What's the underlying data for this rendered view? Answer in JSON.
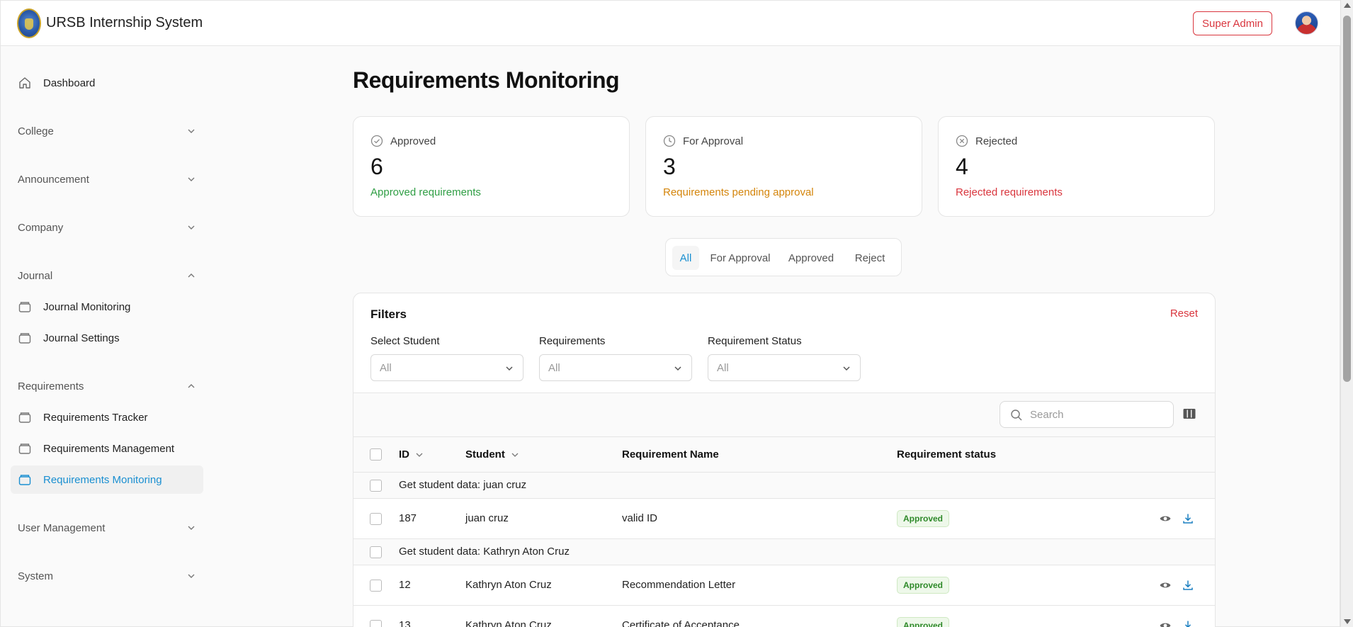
{
  "header": {
    "app_title": "URSB Internship System",
    "role_button": "Super Admin"
  },
  "sidebar": {
    "dashboard": "Dashboard",
    "college": "College",
    "announcement": "Announcement",
    "company": "Company",
    "journal": "Journal",
    "journal_monitoring": "Journal Monitoring",
    "journal_settings": "Journal Settings",
    "requirements": "Requirements",
    "requirements_tracker": "Requirements Tracker",
    "requirements_management": "Requirements Management",
    "requirements_monitoring": "Requirements Monitoring",
    "user_management": "User Management",
    "system": "System"
  },
  "page": {
    "title": "Requirements Monitoring"
  },
  "stats": {
    "approved": {
      "label": "Approved",
      "value": "6",
      "desc": "Approved requirements",
      "color": "#2f9e44"
    },
    "for_approval": {
      "label": "For Approval",
      "value": "3",
      "desc": "Requirements pending approval",
      "color": "#d4850b"
    },
    "rejected": {
      "label": "Rejected",
      "value": "4",
      "desc": "Rejected requirements",
      "color": "#d9363e"
    }
  },
  "tabs": {
    "all": "All",
    "for_approval": "For Approval",
    "approved": "Approved",
    "reject": "Reject"
  },
  "filters": {
    "title": "Filters",
    "reset": "Reset",
    "student_label": "Select Student",
    "student_value": "All",
    "requirements_label": "Requirements",
    "requirements_value": "All",
    "status_label": "Requirement Status",
    "status_value": "All"
  },
  "table": {
    "search_placeholder": "Search",
    "headers": {
      "id": "ID",
      "student": "Student",
      "requirement_name": "Requirement Name",
      "requirement_status": "Requirement status"
    },
    "groups": [
      {
        "title": "Get student data: juan cruz"
      },
      {
        "title": "Get student data: Kathryn Aton Cruz"
      }
    ],
    "rows": [
      {
        "id": "187",
        "student": "juan cruz",
        "requirement": "valid ID",
        "status": "Approved"
      },
      {
        "id": "12",
        "student": "Kathryn Aton Cruz",
        "requirement": "Recommendation Letter",
        "status": "Approved"
      },
      {
        "id": "13",
        "student": "Kathryn Aton Cruz",
        "requirement": "Certificate of Acceptance",
        "status": "Approved"
      }
    ]
  }
}
